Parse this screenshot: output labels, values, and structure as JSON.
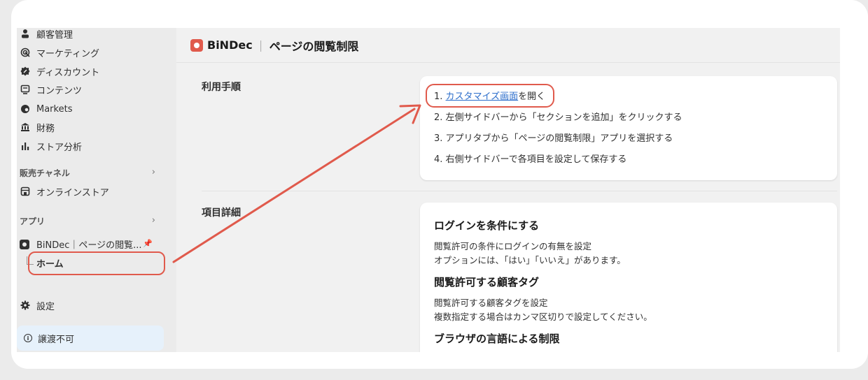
{
  "sidebar": {
    "items": [
      {
        "label": "顧客管理",
        "icon": "person-icon"
      },
      {
        "label": "マーケティング",
        "icon": "target-icon"
      },
      {
        "label": "ディスカウント",
        "icon": "discount-icon"
      },
      {
        "label": "コンテンツ",
        "icon": "content-icon"
      },
      {
        "label": "Markets",
        "icon": "globe-icon"
      },
      {
        "label": "財務",
        "icon": "bank-icon"
      },
      {
        "label": "ストア分析",
        "icon": "bar-chart-icon"
      }
    ],
    "sales_channel_label": "販売チャネル",
    "online_store_label": "オンラインストア",
    "apps_label": "アプリ",
    "app_item_label": "BiNDec｜ページの閲覧...",
    "home_label": "ホーム",
    "settings_label": "設定",
    "notice_label": "譲渡不可"
  },
  "header": {
    "brand": "BiNDec",
    "separator": "｜",
    "page_title": "ページの閲覧制限"
  },
  "usage": {
    "section_title": "利用手順",
    "steps": [
      {
        "prefix": "1. ",
        "link": "カスタマイズ画面",
        "suffix": "を開く"
      },
      {
        "text": "2. 左側サイドバーから「セクションを追加」をクリックする"
      },
      {
        "text": "3. アプリタブから「ページの閲覧制限」アプリを選択する"
      },
      {
        "text": "4. 右側サイドバーで各項目を設定して保存する"
      }
    ]
  },
  "details": {
    "section_title": "項目詳細",
    "blocks": [
      {
        "heading": "ログインを条件にする",
        "lines": [
          "閲覧許可の条件にログインの有無を設定",
          "オプションには、「はい」「いいえ」があります。"
        ]
      },
      {
        "heading": "閲覧許可する顧客タグ",
        "lines": [
          "閲覧許可する顧客タグを設定",
          "複数指定する場合はカンマ区切りで設定してください。"
        ]
      },
      {
        "heading": "ブラウザの言語による制限",
        "lines": []
      }
    ]
  },
  "colors": {
    "accent": "#e05a4c",
    "link": "#2c6ecb",
    "notice_bg": "#e6f1fb"
  }
}
